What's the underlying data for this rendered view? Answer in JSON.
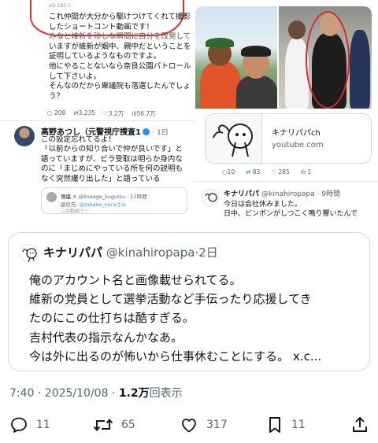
{
  "photo": {
    "left": {
      "tiny": "AD 185 0",
      "lines": [
        "これ仲間が大分から駆けつけてくれて撮影",
        "したショートコント動画です！",
        "みなと維新を珍しな瞬間に自分を改発して",
        "いますが維新が姻中、親中だということを",
        "証明しているようなものですよ。",
        "他にやることないなら奈良公園パトロール",
        "して下さいよ。",
        "そんなのだから衆議院も落選したんでしょ",
        "う？"
      ],
      "stats": [
        "208",
        "3,235",
        "3.2万",
        "56.7万"
      ],
      "author": "高野あつし（元警視庁捜査1",
      "author_meta": "· 1日",
      "body": [
        "この設定忘れてるよ！",
        "「以前からの知り合いで仲が良いです」と",
        "語っていますが、ビラ受取は明らか身内な",
        "のに「まじめにやっている所を何の説明も",
        "なく突然撮り出した」と語っている"
      ],
      "quote_user": "傀儡",
      "quote_handle": "@lineage_kugutsu · 11時間",
      "quote_reply_label": "返信先:",
      "quote_reply": "@takano_naraさん",
      "quote_tail": "この動画で〜"
    },
    "right": {
      "card_title": "キナリパパch",
      "card_domain": "youtube.com",
      "stats": [
        "10",
        "83",
        "285",
        "1"
      ],
      "author": "キナリパパ",
      "author_handle": "@kinahiropapa · 9時間",
      "line1": "今日は会社休みました。",
      "line2": "日中、ピンポンがしつこく鳴り響いたんで"
    }
  },
  "quoted": {
    "name": "キナリパパ",
    "handle": "@kinahiropapa",
    "sep": "·",
    "time": "2日",
    "lines": [
      "俺のアカウント名と画像載せられてる。",
      "維新の党員として選挙活動など手伝ったり応援してき",
      "たのにこの仕打ちは酷すぎる。",
      "吉村代表の指示なんかなあ。",
      "今は外に出るのが怖いから仕事休むことにする。 x.c..."
    ]
  },
  "meta": {
    "time": "7:40 · 2025/10/08 · ",
    "views": "1.2万",
    "views_label": "回表示"
  },
  "actions": {
    "replies": "11",
    "reposts": "65",
    "likes": "317",
    "bookmarks": "11"
  }
}
